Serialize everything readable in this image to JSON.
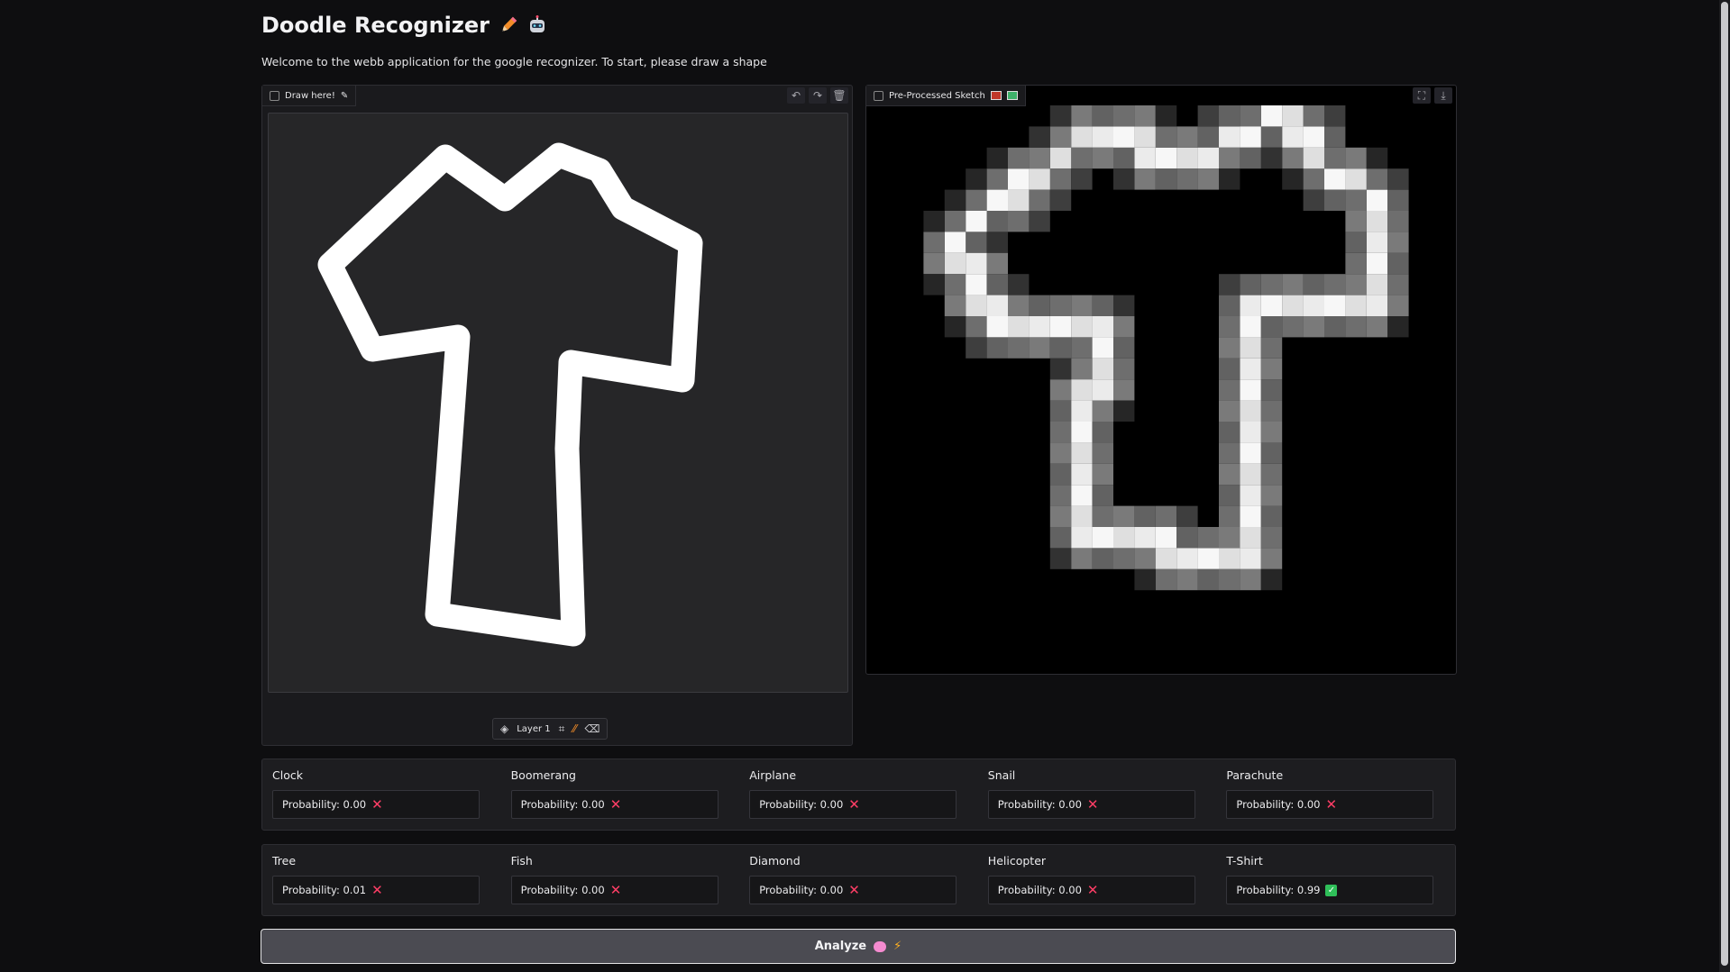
{
  "app": {
    "title": "Doodle Recognizer",
    "subtitle": "Welcome to the webb application for the google recognizer. To start, please draw a shape"
  },
  "draw_panel": {
    "label": "Draw here!",
    "icons": [
      "undo-icon",
      "redo-icon",
      "trash-icon"
    ],
    "layer_label": "Layer 1",
    "layer_tools": [
      "crop-icon",
      "brush-icon",
      "eraser-icon"
    ]
  },
  "preprocessed_panel": {
    "label": "Pre-Processed Sketch",
    "icons": [
      "fullscreen-icon",
      "download-icon"
    ]
  },
  "predictions": {
    "row1": [
      {
        "name": "Clock",
        "text": "Probability: 0.00",
        "status": "no"
      },
      {
        "name": "Boomerang",
        "text": "Probability: 0.00",
        "status": "no"
      },
      {
        "name": "Airplane",
        "text": "Probability: 0.00",
        "status": "no"
      },
      {
        "name": "Snail",
        "text": "Probability: 0.00",
        "status": "no"
      },
      {
        "name": "Parachute",
        "text": "Probability: 0.00",
        "status": "no"
      }
    ],
    "row2": [
      {
        "name": "Tree",
        "text": "Probability: 0.01",
        "status": "no"
      },
      {
        "name": "Fish",
        "text": "Probability: 0.00",
        "status": "no"
      },
      {
        "name": "Diamond",
        "text": "Probability: 0.00",
        "status": "no"
      },
      {
        "name": "Helicopter",
        "text": "Probability: 0.00",
        "status": "no"
      },
      {
        "name": "T-Shirt",
        "text": "Probability: 0.99",
        "status": "yes"
      }
    ]
  },
  "analyze_button": {
    "label": "Analyze"
  },
  "colors": {
    "accent_no": "#ff3e66",
    "accent_yes": "#2fbf59",
    "background": "#0e0e10"
  }
}
